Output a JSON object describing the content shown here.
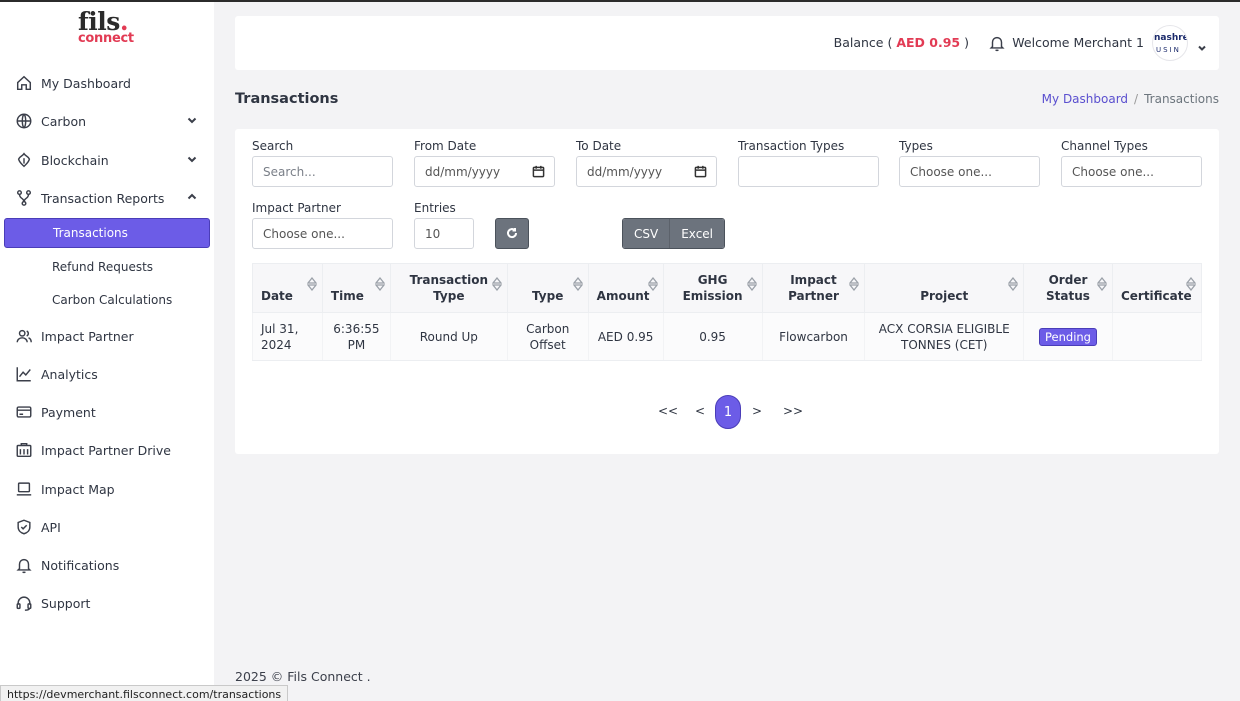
{
  "brand": {
    "logo_top": "fils",
    "logo_dot": ".",
    "logo_bottom": "connect"
  },
  "sidebar": {
    "items": [
      {
        "label": "My Dashboard",
        "icon": "home-icon"
      },
      {
        "label": "Carbon",
        "icon": "globe-icon"
      },
      {
        "label": "Blockchain",
        "icon": "blockchain-icon"
      },
      {
        "label": "Transaction Reports",
        "icon": "branch-icon"
      },
      {
        "label": "Impact Partner",
        "icon": "users-icon"
      },
      {
        "label": "Analytics",
        "icon": "chart-line-icon"
      },
      {
        "label": "Payment",
        "icon": "credit-card-icon"
      },
      {
        "label": "Impact Partner Drive",
        "icon": "drive-icon"
      },
      {
        "label": "Impact Map",
        "icon": "laptop-icon"
      },
      {
        "label": "API",
        "icon": "shield-icon"
      },
      {
        "label": "Notifications",
        "icon": "bell-icon"
      },
      {
        "label": "Support",
        "icon": "headset-icon"
      }
    ],
    "sub_items": [
      "Transactions",
      "Refund Requests",
      "Carbon Calculations"
    ]
  },
  "header": {
    "balance_label": "Balance (",
    "balance_amount": "AED 0.95",
    "balance_close": ")",
    "welcome": "Welcome Merchant 1",
    "avatar_line1": "nashreq",
    "avatar_line2": "USIN"
  },
  "page": {
    "title": "Transactions",
    "breadcrumb": {
      "home": "My Dashboard",
      "sep": "/",
      "current": "Transactions"
    }
  },
  "filters": {
    "search_label": "Search",
    "search_placeholder": "Search...",
    "from_label": "From Date",
    "from_value": "dd/mm/yyyy",
    "to_label": "To Date",
    "to_value": "dd/mm/yyyy",
    "txtypes_label": "Transaction Types",
    "types_label": "Types",
    "types_value": "Choose one...",
    "channel_label": "Channel Types",
    "channel_value": "Choose one...",
    "partner_label": "Impact Partner",
    "partner_value": "Choose one...",
    "entries_label": "Entries",
    "entries_value": "10",
    "csv": "CSV",
    "excel": "Excel"
  },
  "table": {
    "headers": [
      "Date",
      "Time",
      "Transaction Type",
      "Type",
      "Amount",
      "GHG Emission",
      "Impact Partner",
      "Project",
      "Order Status",
      "Certificate"
    ],
    "rows": [
      {
        "date": "Jul 31, 2024",
        "time": "6:36:55 PM",
        "tx_type": "Round Up",
        "type": "Carbon Offset",
        "amount": "AED 0.95",
        "ghg": "0.95",
        "partner": "Flowcarbon",
        "project": "ACX CORSIA ELIGIBLE TONNES (CET)",
        "status": "Pending",
        "certificate": ""
      }
    ]
  },
  "pager": {
    "first": "<<",
    "prev": "<",
    "current": "1",
    "next": ">",
    "last": ">>"
  },
  "footer": "2025 © Fils Connect .",
  "statusbar_url": "https://devmerchant.filsconnect.com/transactions",
  "colors": {
    "accent": "#6c5ce7",
    "brand_red": "#e23b54",
    "button_gray": "#6c737d"
  }
}
